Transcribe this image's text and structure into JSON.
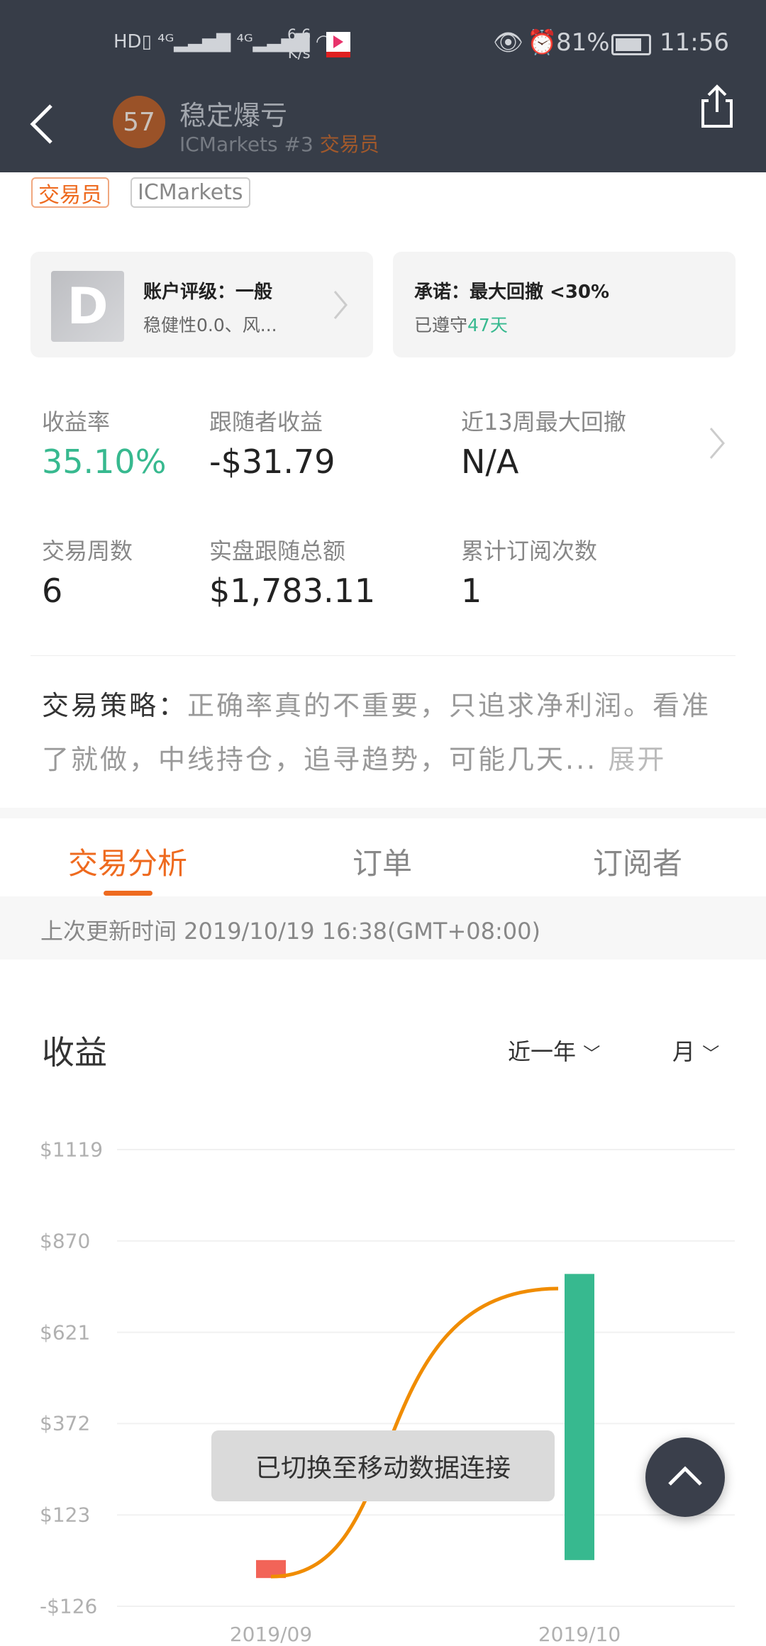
{
  "status_bar": {
    "left_icons": [
      "hd-icon",
      "signal-4g-icon",
      "signal-4g-icon",
      "wifi-icon"
    ],
    "speed": "6.6",
    "speed_unit": "K/s",
    "battery": "81%",
    "time": "11:56"
  },
  "header": {
    "avatar_text": "57",
    "title": "稳定爆亏",
    "subtitle": "ICMarkets #3",
    "subtitle_role": "交易员"
  },
  "tags": [
    "交易员",
    "ICMarkets"
  ],
  "rating_card": {
    "grade": "D",
    "title": "账户评级：一般",
    "subtitle": "稳健性0.0、风..."
  },
  "promise_card": {
    "title": "承诺：最大回撤 <30%",
    "subtitle_prefix": "已遵守",
    "days": "47天"
  },
  "stats": [
    {
      "label": "收益率",
      "value": "35.10%"
    },
    {
      "label": "跟随者收益",
      "value": "-$31.79"
    },
    {
      "label": "近13周最大回撤",
      "value": "N/A"
    },
    {
      "label": "交易周数",
      "value": "6"
    },
    {
      "label": "实盘跟随总额",
      "value": "$1,783.11"
    },
    {
      "label": "累计订阅次数",
      "value": "1"
    }
  ],
  "strategy": {
    "label": "交易策略：",
    "text": "正确率真的不重要，只追求净利润。看准了就做，中线持仓，追寻趋势，可能几天...",
    "expand": "展开"
  },
  "tabs": [
    {
      "label": "交易分析",
      "active": true
    },
    {
      "label": "订单"
    },
    {
      "label": "订阅者"
    }
  ],
  "update_time": "上次更新时间 2019/10/19 16:38(GMT+08:00)",
  "chart_section": {
    "title": "收益",
    "range_select": "近一年",
    "period_select": "月"
  },
  "toast": "已切换至移动数据连接",
  "colors": {
    "header": "#373d48",
    "accent": "#ee6a1f",
    "positive": "#37b98f",
    "negative": "#f26458",
    "line": "#f08c00"
  },
  "chart_data": {
    "type": "bar",
    "categories": [
      "2019/09",
      "2019/10"
    ],
    "series": [
      {
        "type": "bar",
        "values": [
          -49,
          780
        ]
      },
      {
        "type": "line",
        "values": [
          -45,
          740
        ]
      }
    ],
    "yticks": [
      "$1119",
      "$870",
      "$621",
      "$372",
      "$123",
      "-$126"
    ],
    "ytick_values": [
      1119,
      870,
      621,
      372,
      123,
      -126
    ],
    "ylim": [
      -126,
      1119
    ],
    "grid": true
  }
}
